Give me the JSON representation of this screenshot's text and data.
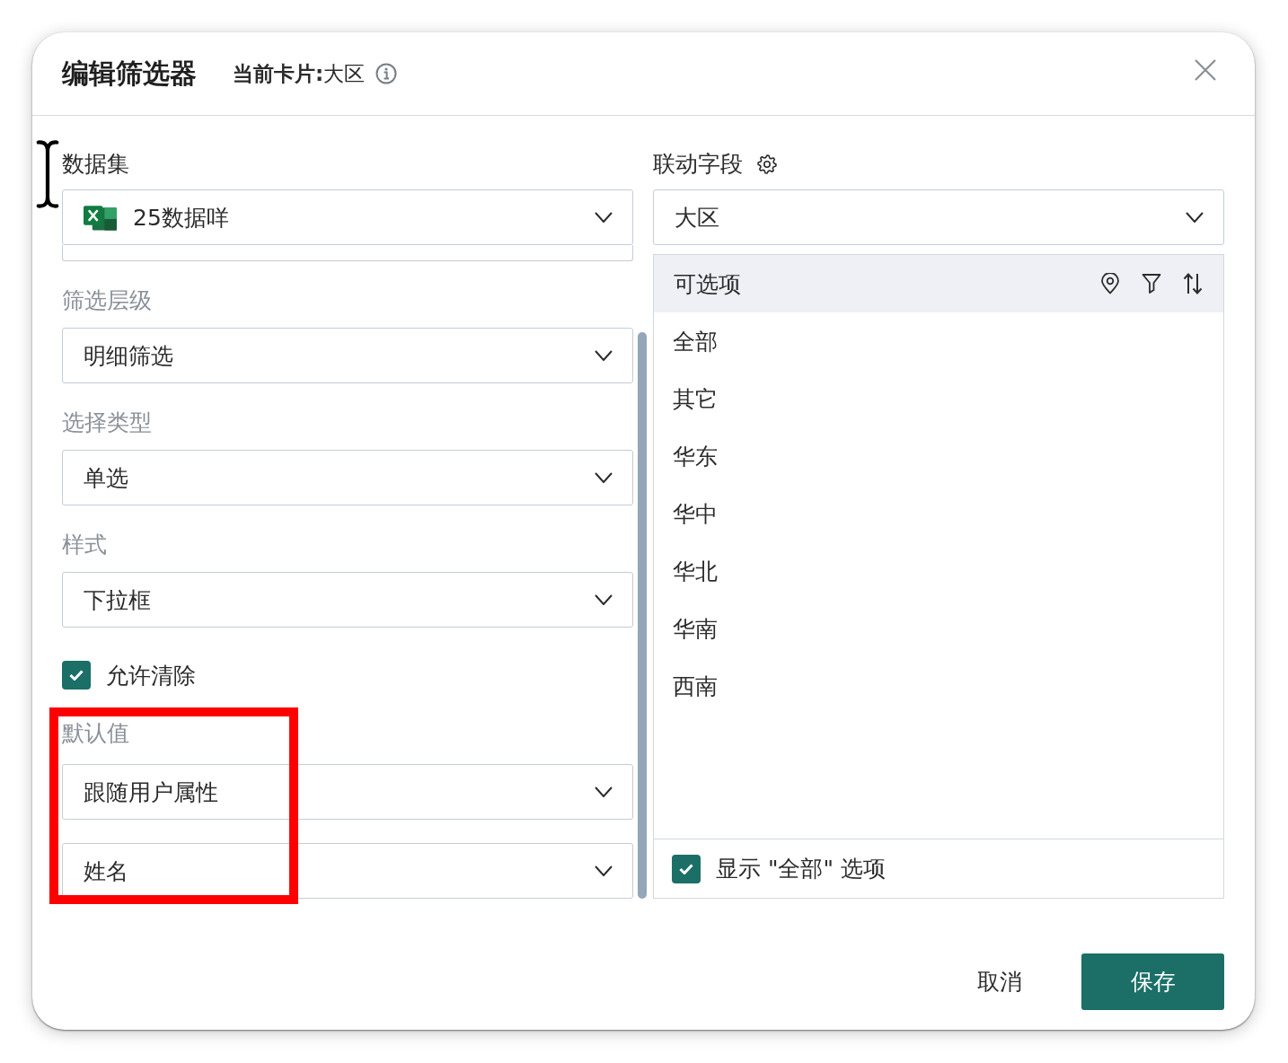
{
  "dialog": {
    "title": "编辑筛选器",
    "subtitle": "**当前卡片:**大区"
  },
  "left_fields": [
    {
      "kind": "dataset",
      "label": "数据集",
      "value": "25数据咩"
    },
    {
      "kind": "select",
      "label": "筛选层级",
      "value": "明细筛选"
    },
    {
      "kind": "select",
      "label": "选择类型",
      "value": "单选"
    },
    {
      "kind": "select",
      "label": "样式",
      "value": "下拉框"
    },
    {
      "kind": "checkbox",
      "label": "允许清除",
      "checked": true
    },
    {
      "kind": "multi-select",
      "label": "默认值",
      "values": [
        "跟随用户属性",
        "姓名"
      ]
    }
  ],
  "linked_field": {
    "label": "联动字段",
    "value": "大区"
  },
  "options": {
    "title": "可选项",
    "items": [
      "全部",
      "其它",
      "华东",
      "华中",
      "华北",
      "华南",
      "西南"
    ],
    "show_all": {
      "label": "显示 \"全部\" 选项",
      "checked": true
    }
  },
  "buttons": [
    {
      "kind": "cancel",
      "label": "取消"
    },
    {
      "kind": "save",
      "label": "保存"
    }
  ]
}
